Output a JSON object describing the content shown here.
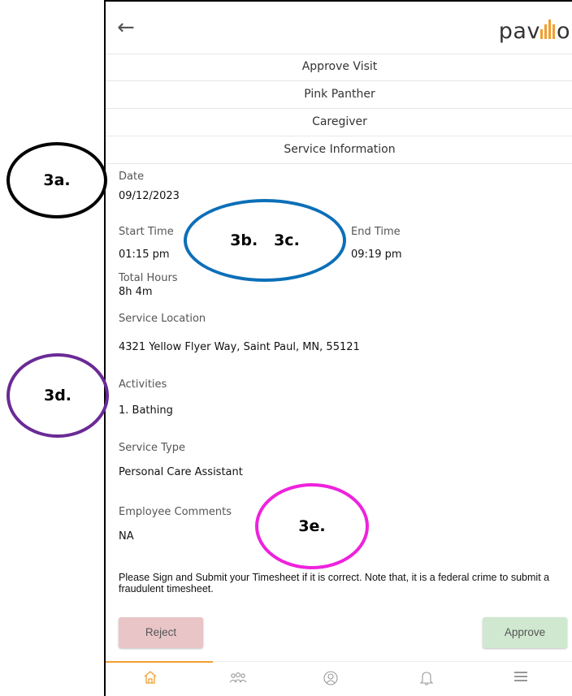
{
  "header": {
    "back_icon": "arrow-left-icon",
    "logo_prefix": "pav",
    "logo_suffix": "o"
  },
  "sections": [
    "Approve Visit",
    "Pink Panther",
    "Caregiver",
    "Service Information"
  ],
  "fields": {
    "date_label": "Date",
    "date_value": "09/12/2023",
    "start_label": "Start Time",
    "start_value": "01:15 pm",
    "end_label": "End Time",
    "end_value": "09:19 pm",
    "hours_label": "Total Hours",
    "hours_value": "8h 4m",
    "location_label": "Service Location",
    "location_value": "4321 Yellow Flyer Way, Saint Paul, MN, 55121",
    "activities_label": "Activities",
    "activities_value": "1. Bathing",
    "service_type_label": "Service Type",
    "service_type_value": "Personal Care Assistant",
    "comments_label": "Employee Comments",
    "comments_value": "NA"
  },
  "notice": "Please Sign and Submit your Timesheet if it is correct. Note that, it is a federal crime to submit a fraudulent timesheet.",
  "buttons": {
    "reject": "Reject",
    "approve": "Approve"
  },
  "nav": [
    "home-icon",
    "people-icon",
    "profile-icon",
    "bell-icon",
    "menu-icon"
  ],
  "annotations": {
    "a": "3a.",
    "b": "3b.   3c.",
    "d": "3d.",
    "e": "3e."
  },
  "colors": {
    "accent": "#f0a030",
    "reject_bg": "#e9c5c8",
    "approve_bg": "#cfe8cf"
  }
}
